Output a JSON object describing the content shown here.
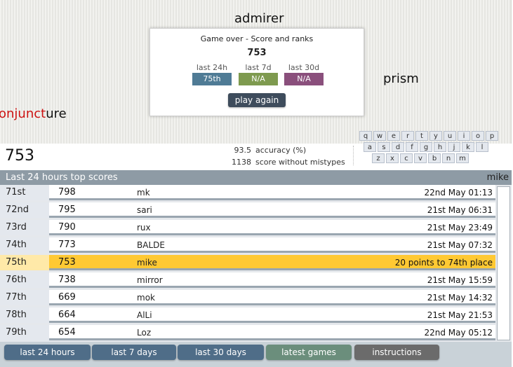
{
  "play_area": {
    "words": [
      {
        "typed": "",
        "rest": "admirer"
      },
      {
        "typed": "",
        "rest": "prism"
      },
      {
        "typed": "onjunct",
        "rest": "ure"
      }
    ]
  },
  "modal": {
    "title": "Game over - Score and ranks",
    "score": "753",
    "ranks": [
      {
        "label": "last 24h",
        "value": "75th",
        "color": "#4f7b95"
      },
      {
        "label": "last 7d",
        "value": "N/A",
        "color": "#7e9a4f"
      },
      {
        "label": "last 30d",
        "value": "N/A",
        "color": "#8a4f7c"
      }
    ],
    "play_again": "play again"
  },
  "keyboard": {
    "row1": [
      "q",
      "w",
      "e",
      "r",
      "t",
      "y",
      "u",
      "i",
      "o",
      "p"
    ],
    "row2": [
      "a",
      "s",
      "d",
      "f",
      "g",
      "h",
      "j",
      "k",
      "l"
    ],
    "row3": [
      "z",
      "x",
      "c",
      "v",
      "b",
      "n",
      "m"
    ]
  },
  "stats": {
    "score": "753",
    "accuracy_value": "93.5",
    "accuracy_label": "accuracy (%)",
    "clean_value": "1138",
    "clean_label": "score without mistypes"
  },
  "table": {
    "title": "Last 24 hours top scores",
    "user": "mike",
    "rows": [
      {
        "rank": "71st",
        "score": "798",
        "name": "mk",
        "date": "22nd May 01:13"
      },
      {
        "rank": "72nd",
        "score": "795",
        "name": "sari",
        "date": "21st May 06:31"
      },
      {
        "rank": "73rd",
        "score": "790",
        "name": "rux",
        "date": "21st May 23:49"
      },
      {
        "rank": "74th",
        "score": "773",
        "name": "BALDE",
        "date": "21st May 07:32"
      },
      {
        "rank": "75th",
        "score": "753",
        "name": "mike",
        "date": "20 points to 74th place"
      },
      {
        "rank": "76th",
        "score": "738",
        "name": "mirror",
        "date": "21st May 15:59"
      },
      {
        "rank": "77th",
        "score": "669",
        "name": "mok",
        "date": "21st May 14:32"
      },
      {
        "rank": "78th",
        "score": "664",
        "name": "AlLi",
        "date": "21st May 21:53"
      },
      {
        "rank": "79th",
        "score": "654",
        "name": "Loz",
        "date": "22nd May 05:12"
      }
    ]
  },
  "buttons": {
    "last24": "last 24 hours",
    "last7": "last 7 days",
    "last30": "last 30  days",
    "latest": "latest games",
    "instructions": "instructions"
  }
}
